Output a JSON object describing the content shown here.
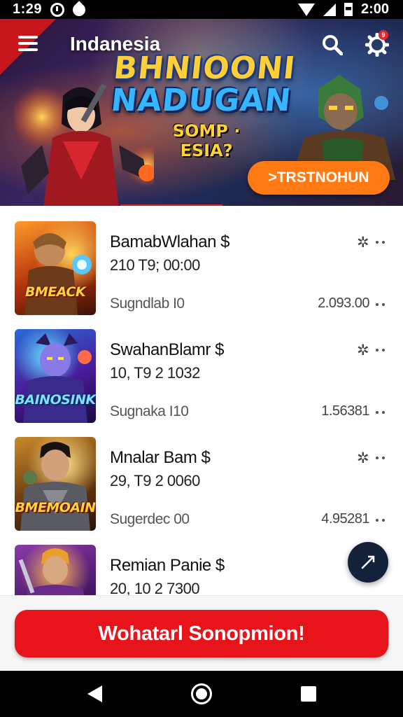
{
  "status_bar": {
    "time_left": "1:29",
    "time_right": "2:00"
  },
  "header": {
    "region_label": "Indanesia",
    "notification_count": "9"
  },
  "banner": {
    "title_line1": "BHNIOONI",
    "title_line2": "NADUGAN",
    "subtitle": "SOMP · ESIA?",
    "cta_label": ">TRSTNOHUN"
  },
  "games": [
    {
      "name": "BamabWlahan",
      "date": "210 T9; 00:00",
      "meta": "Sugndlab I0",
      "value": "2.093.00",
      "thumb_label": "BMEACK",
      "thumb_style": "fire"
    },
    {
      "name": "SwahanBlamr",
      "date": "10, T9 2 1032",
      "meta": "Sugnaka I10",
      "value": "1.56381",
      "thumb_label": "BAINOSINK",
      "thumb_style": "blue"
    },
    {
      "name": "Mnalar Bam",
      "date": "29, T9 2 0060",
      "meta": "Sugerdec 00",
      "value": "4.95281",
      "thumb_label": "BMEMOAIN",
      "thumb_style": "gold"
    },
    {
      "name": "Remian Panie",
      "date": "20, 10 2 7300",
      "meta": "",
      "value": "",
      "thumb_label": "",
      "thumb_style": "purple"
    }
  ],
  "row_symbols": {
    "currency": "$",
    "gear": "✲"
  },
  "primary_action": {
    "label": "Wohatarl Sonopmion!"
  },
  "colors": {
    "accent": "#e8141b",
    "cta_orange": "#ff7a12",
    "fab": "#13213a"
  }
}
